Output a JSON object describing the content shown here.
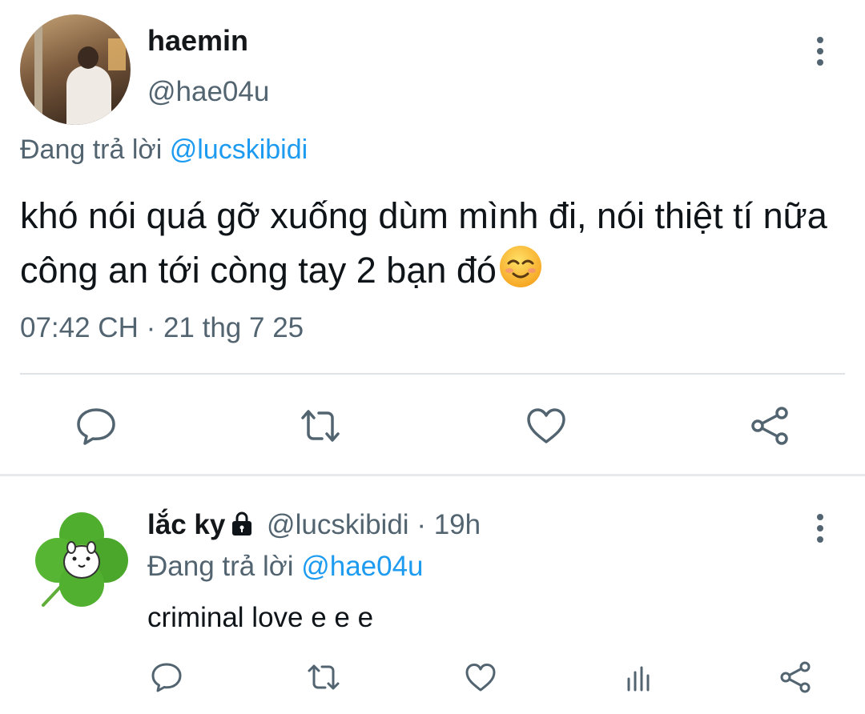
{
  "main_tweet": {
    "display_name": "haemin",
    "handle": "@hae04u",
    "reply_prefix": "Đang trả lời",
    "reply_mention": "@lucskibidi",
    "text": "khó nói quá gỡ xuống dùm mình đi, nói thiệt tí nữa công an tới còng tay 2 bạn đó",
    "emoji": "smiling-face-icon",
    "timestamp": "07:42 CH · 21 thg 7 25",
    "actions": [
      "reply-icon",
      "retweet-icon",
      "like-icon",
      "share-icon"
    ]
  },
  "reply_tweet": {
    "display_name": "lắc ky",
    "handle": "@lucskibidi",
    "time": "· 19h",
    "reply_prefix": "Đang trả lời",
    "reply_mention": "@hae04u",
    "text": "criminal love e e e",
    "actions": [
      "reply-icon",
      "retweet-icon",
      "like-icon",
      "analytics-icon",
      "share-icon"
    ]
  },
  "colors": {
    "accent": "#1d9bf0",
    "secondary_text": "#536471",
    "primary_text": "#0f1419",
    "divider": "#dfe3e6"
  }
}
